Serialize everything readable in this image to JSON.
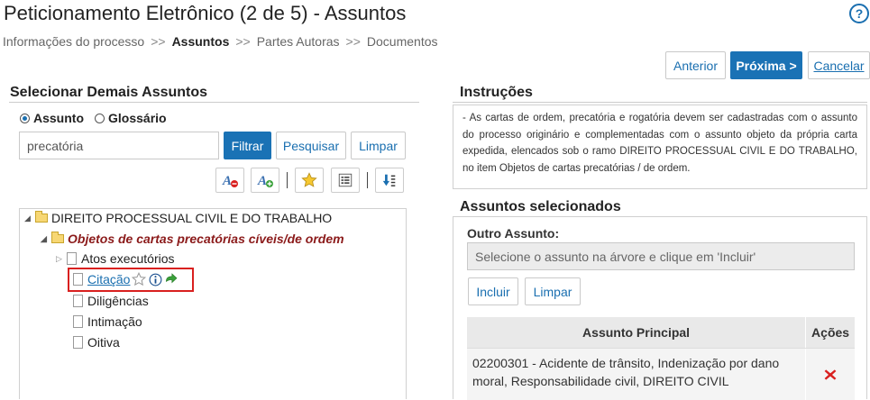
{
  "header": {
    "title": "Peticionamento Eletrônico (2 de 5) - Assuntos",
    "help_symbol": "?"
  },
  "breadcrumb": {
    "items": [
      "Informações do processo",
      "Assuntos",
      "Partes Autoras",
      "Documentos"
    ],
    "separator": ">>"
  },
  "nav_buttons": {
    "previous": "Anterior",
    "next": "Próxima >",
    "cancel": "Cancelar"
  },
  "left_panel": {
    "title": "Selecionar Demais Assuntos",
    "radio_options": [
      "Assunto",
      "Glossário"
    ],
    "selected_radio": "Assunto",
    "search_value": "precatória",
    "filter_button": "Filtrar",
    "search_button": "Pesquisar",
    "clear_button": "Limpar",
    "tree": {
      "root": "DIREITO PROCESSUAL CIVIL E DO TRABALHO",
      "child": "Objetos de cartas precatórias cíveis/de ordem",
      "items": [
        "Atos executórios",
        "Citação",
        "Diligências",
        "Intimação",
        "Oitiva"
      ]
    }
  },
  "instructions": {
    "title": "Instruções",
    "text": "- As cartas de ordem, precatória e rogatória devem ser cadastradas com o assunto do processo originário e complementadas com o assunto objeto da própria carta expedida, elencados sob o ramo DIREITO PROCESSUAL CIVIL E DO TRABALHO, no item Objetos de cartas precatórias / de ordem."
  },
  "selected_subjects": {
    "title": "Assuntos selecionados",
    "other_label": "Outro Assunto:",
    "other_placeholder": "Selecione o assunto na árvore e clique em 'Incluir'",
    "include_button": "Incluir",
    "clear_button": "Limpar",
    "table": {
      "headers": [
        "Assunto Principal",
        "Ações"
      ],
      "rows": [
        {
          "subject": "02200301 - Acidente de trânsito, Indenização por dano moral, Responsabilidade civil, DIREITO CIVIL"
        }
      ]
    }
  },
  "colors": {
    "accent": "#1a72b5",
    "highlight_border": "#d9201f",
    "tree_child_text": "#8b1a1a",
    "delete_icon": "#d9201f"
  }
}
